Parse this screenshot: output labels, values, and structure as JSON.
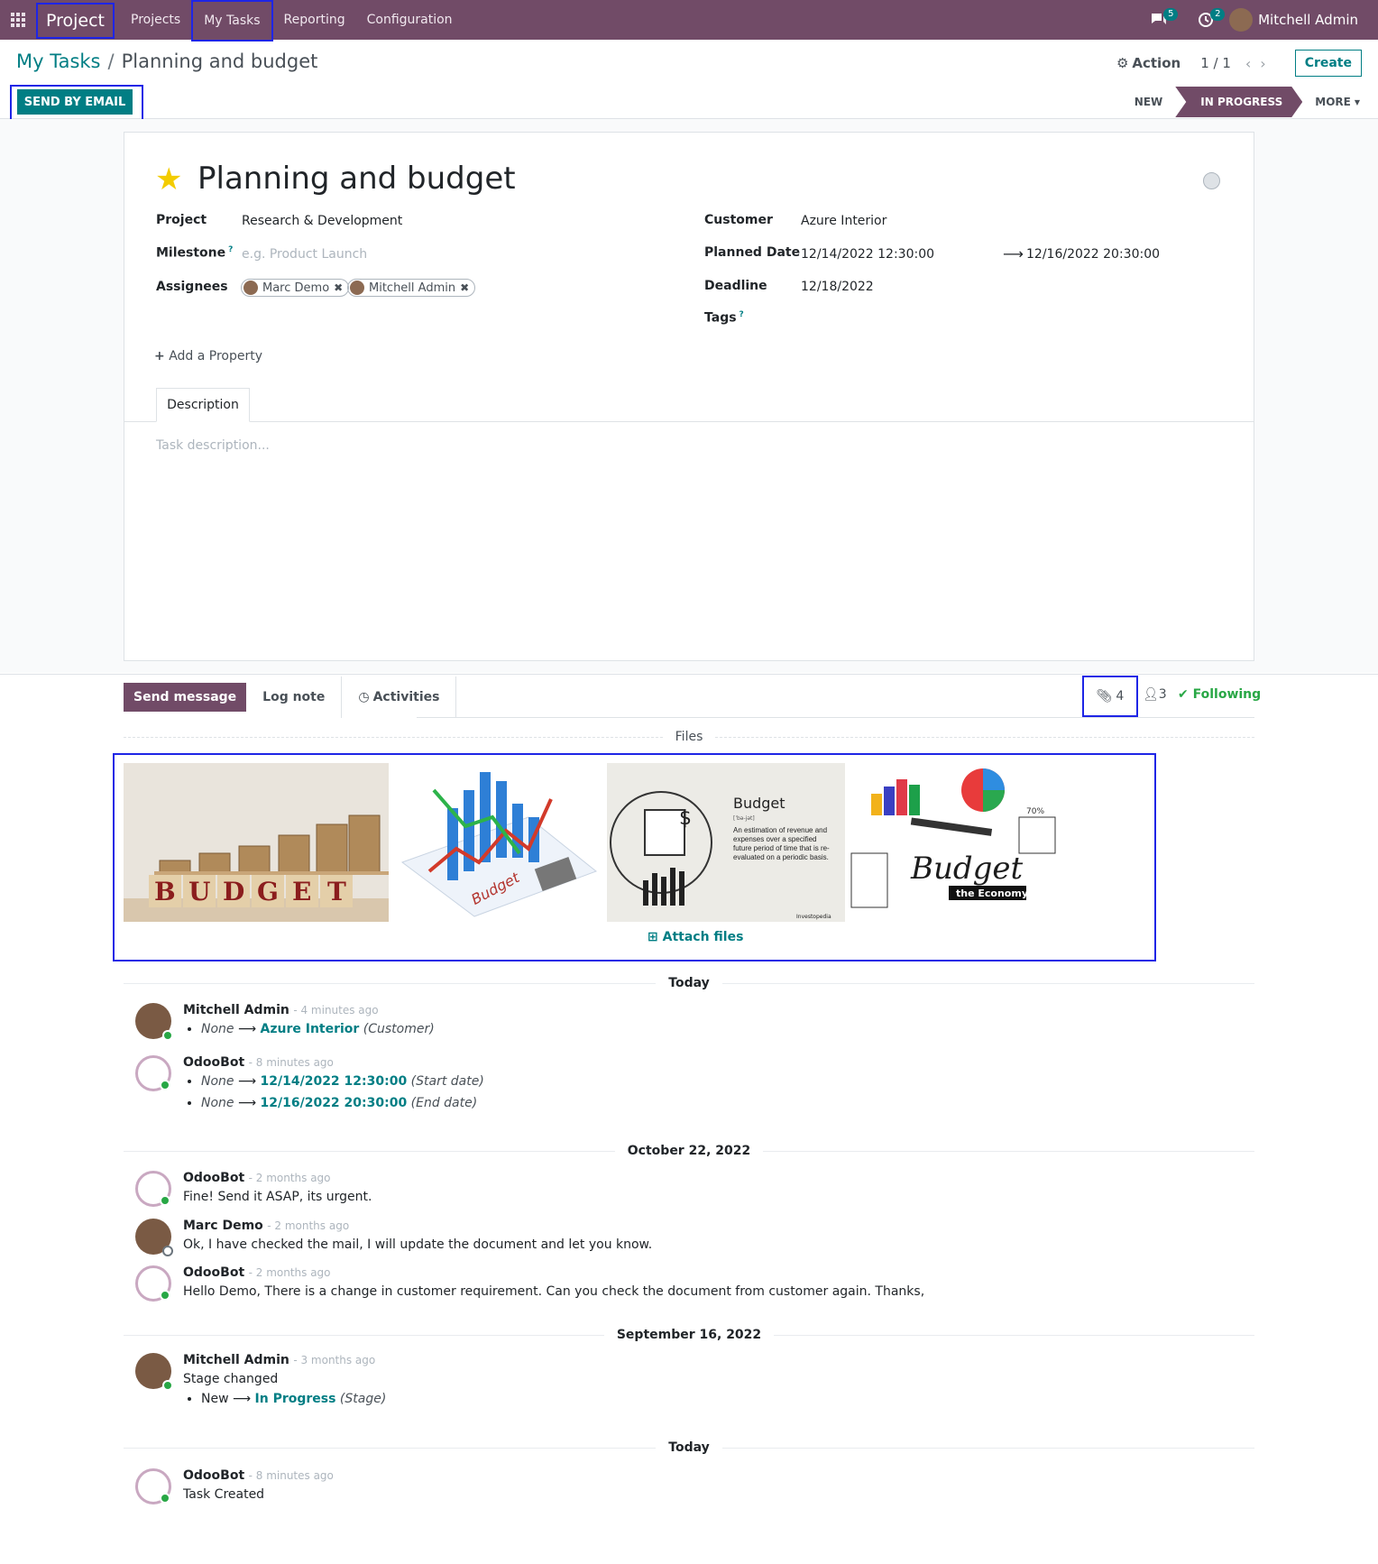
{
  "navbar": {
    "brand": "Project",
    "menu": [
      "Projects",
      "My Tasks",
      "Reporting",
      "Configuration"
    ],
    "messages_count": "5",
    "activities_count": "2",
    "user_name": "Mitchell Admin"
  },
  "control_panel": {
    "breadcrumb_parent": "My Tasks",
    "breadcrumb_current": "Planning and budget",
    "action_label": "Action",
    "pager": "1 / 1",
    "create_label": "Create",
    "send_email_label": "SEND BY EMAIL",
    "stages": [
      "NEW",
      "IN PROGRESS"
    ],
    "more_label": "MORE"
  },
  "task": {
    "title": "Planning and budget",
    "fields": {
      "project_label": "Project",
      "project_value": "Research & Development",
      "milestone_label": "Milestone",
      "milestone_placeholder": "e.g. Product Launch",
      "assignees_label": "Assignees",
      "assignees": [
        "Marc Demo",
        "Mitchell Admin"
      ],
      "customer_label": "Customer",
      "customer_value": "Azure Interior",
      "planned_date_label": "Planned Date",
      "planned_start": "12/14/2022 12:30:00",
      "planned_end": "12/16/2022 20:30:00",
      "deadline_label": "Deadline",
      "deadline_value": "12/18/2022",
      "tags_label": "Tags",
      "help_mark": "?"
    },
    "add_property_label": "Add a Property",
    "tab_description": "Description",
    "description_placeholder": "Task description..."
  },
  "chatter": {
    "send_message_label": "Send message",
    "log_note_label": "Log note",
    "activities_label": "Activities",
    "attachments_count": "4",
    "followers_count": "3",
    "following_label": "Following",
    "files_label": "Files",
    "attach_files_label": "Attach files",
    "file_images": [
      "budget-wooden-blocks",
      "budget-bar-chart-calculator",
      "budget-investopedia-definition",
      "budget-the-economy"
    ],
    "image_texts": {
      "blocks": [
        "B",
        "U",
        "D",
        "G",
        "E",
        "T"
      ],
      "chart": "Budget",
      "def_title": "Budget",
      "def_pron": "[ˈbə-jət]",
      "def_text": "An estimation of revenue and expenses over a specified future period of time that is re-evaluated on a periodic basis.",
      "def_brand": "Investopedia",
      "econ_title": "Budget",
      "econ_sub": "the Economy",
      "econ_pct": "70%"
    },
    "date_separators": [
      "Today",
      "October 22, 2022",
      "September 16, 2022",
      "Today"
    ],
    "messages": [
      {
        "author": "Mitchell Admin",
        "time": "- 4 minutes ago",
        "changes": [
          {
            "old": "None",
            "new": "Azure Interior",
            "field": "(Customer)"
          }
        ]
      },
      {
        "author": "OdooBot",
        "time": "- 8 minutes ago",
        "changes": [
          {
            "old": "None",
            "new": "12/14/2022 12:30:00",
            "field": "(Start date)"
          },
          {
            "old": "None",
            "new": "12/16/2022 20:30:00",
            "field": "(End date)"
          }
        ]
      },
      {
        "author": "OdooBot",
        "time": "- 2 months ago",
        "text": "Fine! Send it ASAP, its urgent."
      },
      {
        "author": "Marc Demo",
        "time": "- 2 months ago",
        "text": "Ok, I have checked the mail, I will update the document and let you know."
      },
      {
        "author": "OdooBot",
        "time": "- 2 months ago",
        "text": "Hello Demo, There is a change in customer requirement. Can you check the document from customer again. Thanks,"
      },
      {
        "author": "Mitchell Admin",
        "time": "- 3 months ago",
        "text": "Stage changed",
        "changes": [
          {
            "old": "New",
            "new": "In Progress",
            "field": "(Stage)"
          }
        ]
      },
      {
        "author": "OdooBot",
        "time": "- 8 minutes ago",
        "text": "Task Created"
      }
    ]
  },
  "colors": {
    "brand": "#714b67",
    "accent": "#017e84",
    "highlight_box": "#1e25e6",
    "star": "#f3cc00"
  }
}
